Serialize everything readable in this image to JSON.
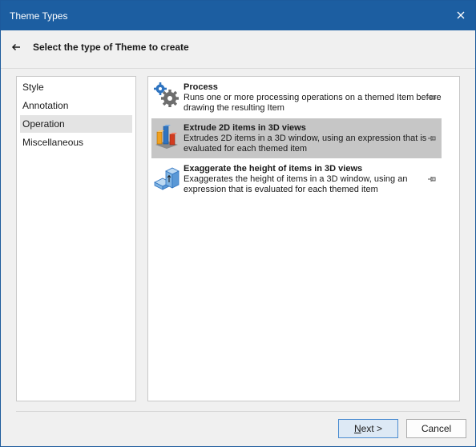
{
  "window": {
    "title": "Theme Types"
  },
  "header": {
    "heading": "Select the type of Theme to create"
  },
  "categories": [
    {
      "label": "Style",
      "selected": false
    },
    {
      "label": "Annotation",
      "selected": false
    },
    {
      "label": "Operation",
      "selected": true
    },
    {
      "label": "Miscellaneous",
      "selected": false
    }
  ],
  "types": [
    {
      "name": "Process",
      "description": "Runs one or more processing operations on a themed Item before drawing the resulting Item",
      "icon": "gears-icon",
      "selected": false
    },
    {
      "name": "Extrude 2D items in 3D views",
      "description": "Extrudes 2D items in a 3D window, using an expression that is evaluated for each themed item",
      "icon": "extrude-bars-icon",
      "selected": true
    },
    {
      "name": "Exaggerate the height of items in 3D views",
      "description": "Exaggerates the height of items in a 3D window, using an expression that is evaluated for each themed item",
      "icon": "exaggerate-height-icon",
      "selected": false
    }
  ],
  "buttons": {
    "next_mnemonic": "N",
    "next_rest": "ext >",
    "cancel": "Cancel"
  },
  "colors": {
    "titlebar": "#1c5ea1",
    "selected_type": "#c6c6c6",
    "selected_category": "#e4e4e4",
    "next_border": "#4a8bd0"
  }
}
